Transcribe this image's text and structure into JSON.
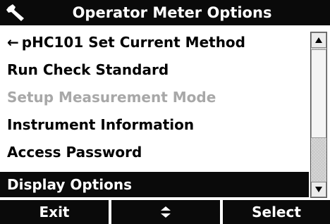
{
  "header": {
    "title": "Operator Meter Options",
    "icon": "wrench-icon"
  },
  "menu": {
    "items": [
      {
        "label": "pHC101 Set Current Method",
        "arrow": "←",
        "state": "normal"
      },
      {
        "label": "Run Check Standard",
        "state": "normal"
      },
      {
        "label": "Setup Measurement Mode",
        "state": "disabled"
      },
      {
        "label": "Instrument Information",
        "state": "normal"
      },
      {
        "label": "Access Password",
        "state": "normal"
      },
      {
        "label": "Display Options",
        "state": "selected"
      }
    ]
  },
  "softkeys": {
    "left": "Exit",
    "middle_icon": "up-down-arrows-icon",
    "right": "Select"
  },
  "colors": {
    "bar": "#0a0a0a",
    "text_on_bar": "#ffffff",
    "disabled_text": "#a8a8a8"
  }
}
